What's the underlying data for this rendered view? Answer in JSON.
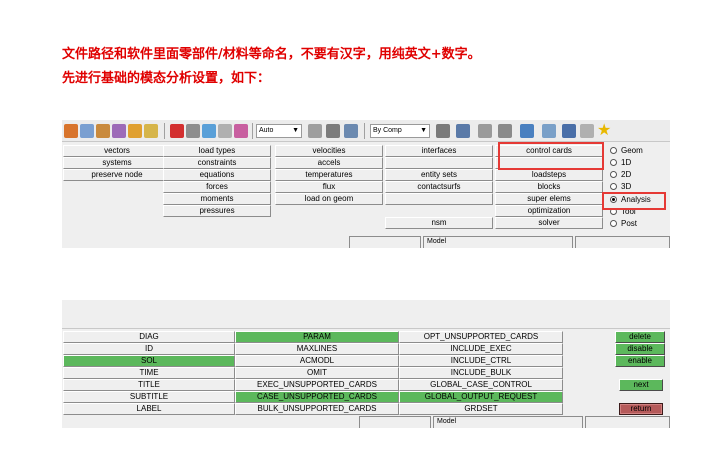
{
  "notes": {
    "line1": "文件路径和软件里面零部件/材料等命名，不要有汉字，用纯英文+数字。",
    "line2": "先进行基础的模态分析设置，如下："
  },
  "panel1": {
    "toolbar": {
      "display_select": "Auto",
      "color_select": "By Comp"
    },
    "columns": [
      [
        "vectors",
        "systems",
        "preserve node"
      ],
      [
        "load types",
        "constraints",
        "equations",
        "forces",
        "moments",
        "pressures"
      ],
      [
        "velocities",
        "accels",
        "temperatures",
        "flux",
        "load on geom"
      ],
      [
        "interfaces",
        "",
        "entity sets",
        "contactsurfs",
        "",
        "nsm"
      ],
      [
        "control cards",
        "",
        "loadsteps",
        "blocks",
        "super elems",
        "optimization",
        "solver"
      ]
    ],
    "radios": [
      "Geom",
      "1D",
      "2D",
      "3D",
      "Analysis",
      "Tool",
      "Post"
    ],
    "selected_radio": "Analysis",
    "bottom_bar": "Model",
    "colors": {
      "highlight_box": "#e53935",
      "panel_bg": "#efefef"
    }
  },
  "panel2": {
    "col1": [
      "DIAG",
      "ID",
      "SOL",
      "TIME",
      "TITLE",
      "SUBTITLE",
      "LABEL"
    ],
    "col2": [
      "PARAM",
      "MAXLINES",
      "ACMODL",
      "OMIT",
      "EXEC_UNSUPPORTED_CARDS",
      "CASE_UNSUPPORTED_CARDS",
      "BULK_UNSUPPORTED_CARDS"
    ],
    "col3": [
      "OPT_UNSUPPORTED_CARDS",
      "INCLUDE_EXEC",
      "INCLUDE_CTRL",
      "INCLUDE_BULK",
      "GLOBAL_CASE_CONTROL",
      "GLOBAL_OUTPUT_REQUEST",
      "GRDSET"
    ],
    "buttons": {
      "delete": "delete",
      "disable": "disable",
      "enable": "enable",
      "next": "next",
      "return": "return"
    },
    "bottom_bar": "Model",
    "colors": {
      "selected": "#5cb85c",
      "return_button": "#b55a5a"
    }
  }
}
